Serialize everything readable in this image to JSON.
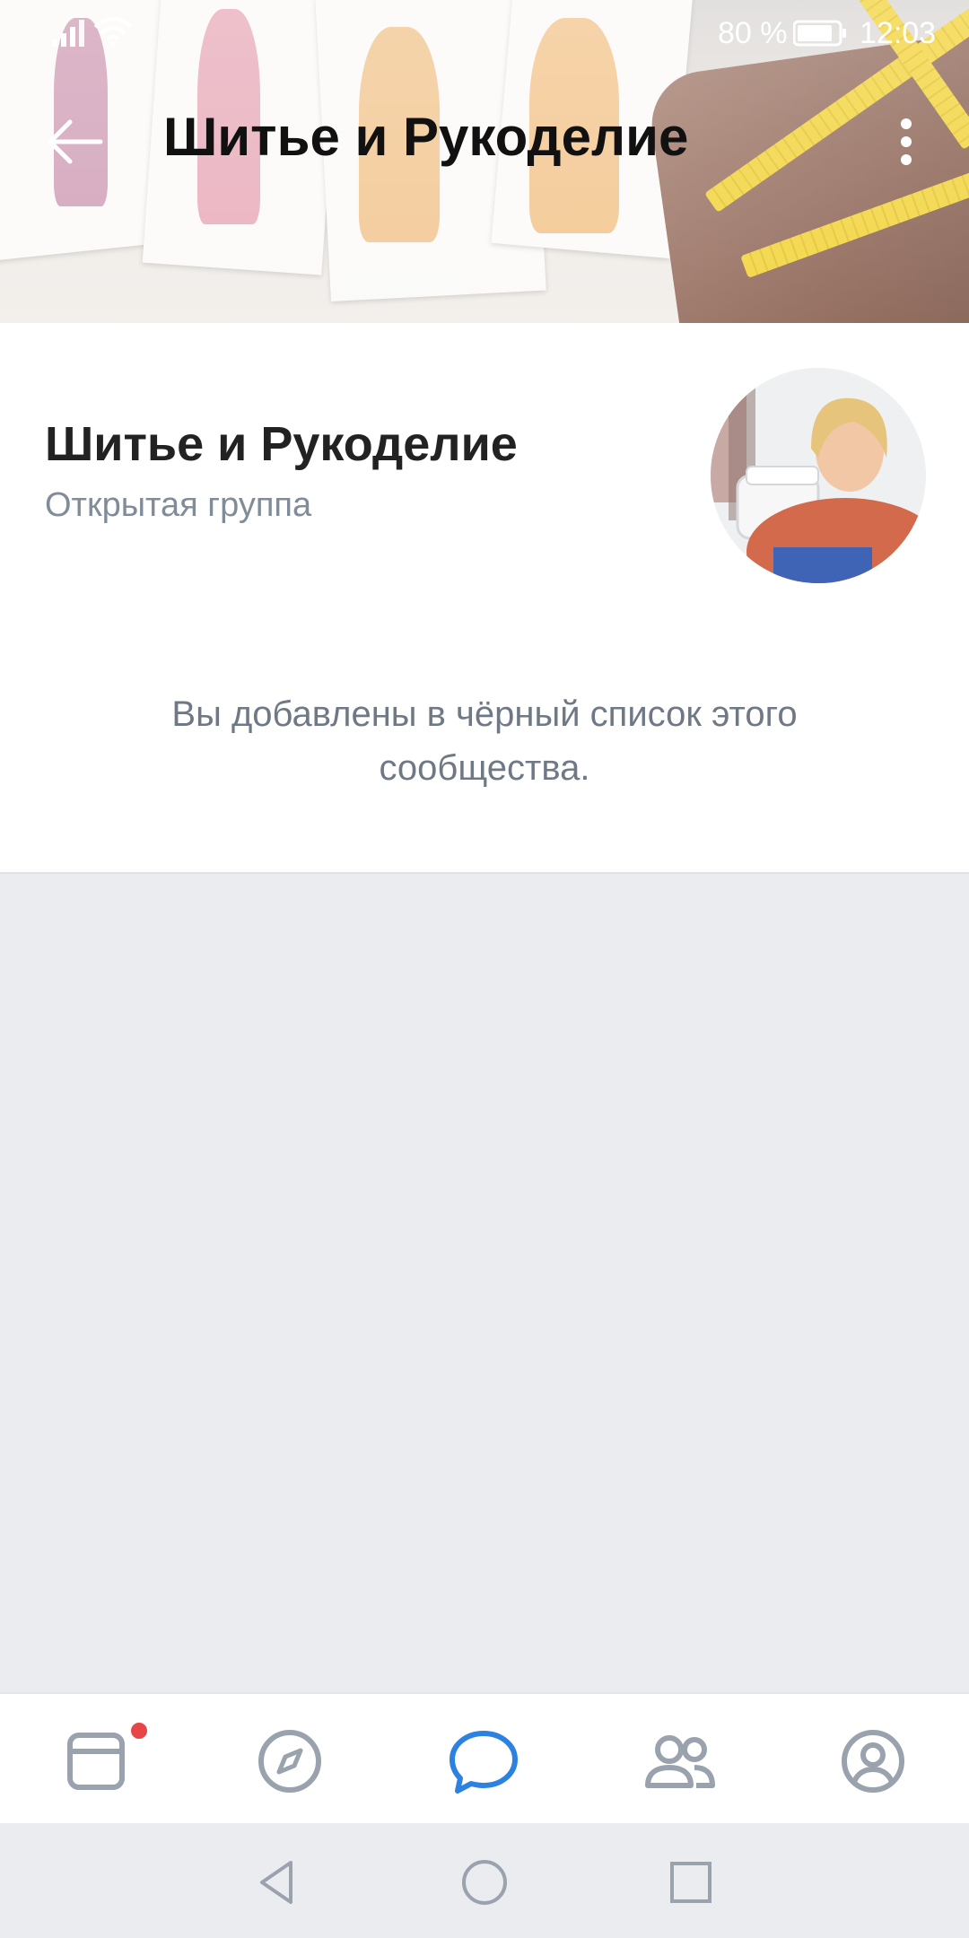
{
  "status_bar": {
    "battery_percent": "80 %",
    "time": "12:03"
  },
  "header": {
    "title": "Шитье и Рукоделие"
  },
  "group": {
    "name": "Шитье и Рукоделие",
    "type": "Открытая группа",
    "message": "Вы добавлены в чёрный список этого сообщества."
  },
  "tab_bar": {
    "tabs": [
      {
        "id": "news",
        "icon": "newsfeed-icon",
        "has_badge": true
      },
      {
        "id": "explore",
        "icon": "compass-icon",
        "has_badge": false
      },
      {
        "id": "messages",
        "icon": "chat-bubble-icon",
        "active": true
      },
      {
        "id": "friends",
        "icon": "friends-icon",
        "has_badge": false
      },
      {
        "id": "profile",
        "icon": "profile-icon",
        "has_badge": false
      }
    ]
  },
  "colors": {
    "accent": "#2D81E0",
    "tab_inactive": "#99A2AD",
    "badge": "#E64646",
    "secondary_text": "#818C99",
    "background": "#EBECF0"
  }
}
